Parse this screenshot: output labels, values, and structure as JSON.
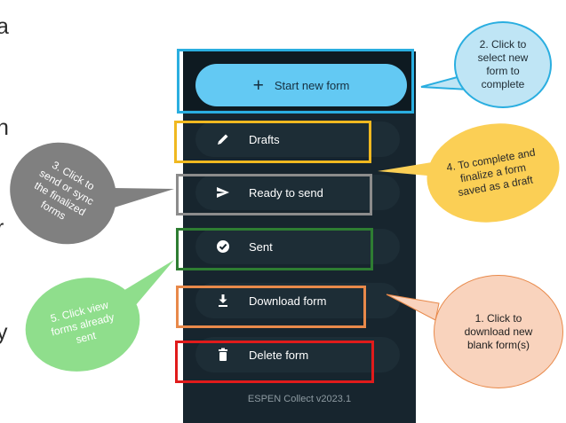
{
  "side_letters": [
    "a",
    "n",
    "r",
    "y"
  ],
  "menu": {
    "start_new_form": "Start new form",
    "drafts": "Drafts",
    "ready_to_send": "Ready to send",
    "sent": "Sent",
    "download_form": "Download form",
    "delete_form": "Delete form"
  },
  "version": "ESPEN Collect v2023.1",
  "callouts": {
    "c1": "1. Click to download new blank form(s)",
    "c2": "2. Click to select new form to complete",
    "c3": "3. Click to send or sync the finalized forms",
    "c4": "4. To complete and finalize a form saved as a draft",
    "c5": "5. Click view forms already sent"
  },
  "colors": {
    "phone_bg": "#17252e",
    "start_button": "#63c9f3",
    "highlight_start": "#2aaee0",
    "highlight_drafts": "#f0b820",
    "highlight_ready": "#8c8c8c",
    "highlight_sent": "#2e7d32",
    "highlight_download": "#e8894a",
    "highlight_delete": "#e01b1b",
    "bubble_1": "#f9d3bd",
    "bubble_2": "#bfe5f5",
    "bubble_3": "#808080",
    "bubble_4": "#fbcf55",
    "bubble_5": "#8fde8c"
  }
}
